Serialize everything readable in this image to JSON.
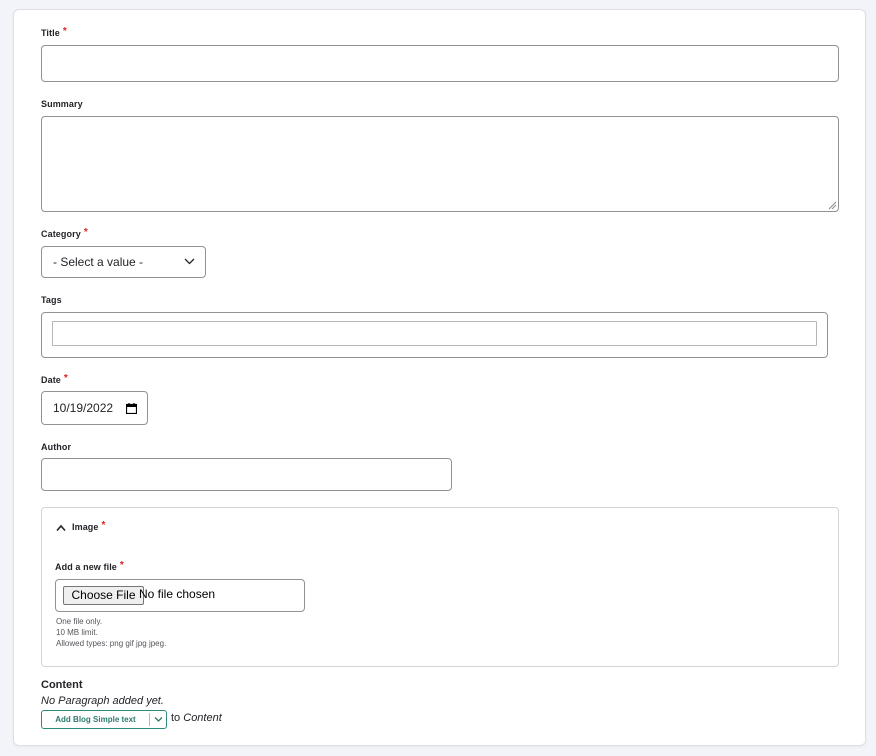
{
  "form": {
    "title": {
      "label": "Title",
      "required_mark": "*",
      "value": ""
    },
    "summary": {
      "label": "Summary",
      "value": ""
    },
    "category": {
      "label": "Category",
      "required_mark": "*",
      "selected": "- Select a value -"
    },
    "tags": {
      "label": "Tags",
      "value": ""
    },
    "date": {
      "label": "Date",
      "required_mark": "*",
      "value": "10/19/2022"
    },
    "author": {
      "label": "Author",
      "value": ""
    },
    "image": {
      "legend": "Image",
      "required_mark": "*",
      "add_file_label": "Add a new file",
      "add_file_required_mark": "*",
      "choose_button": "Choose File",
      "no_file_text": "No file chosen",
      "help": [
        "One file only.",
        "10 MB limit.",
        "Allowed types: png gif jpg jpeg."
      ]
    },
    "content": {
      "heading": "Content",
      "empty_text": "No Paragraph added yet.",
      "add_button": "Add Blog Simple text",
      "to_text": "to",
      "to_target": "Content"
    }
  },
  "colors": {
    "required": "#dc2323",
    "accent": "#2b8a7e",
    "border": "#919297"
  },
  "icons": [
    "chevron-down-icon",
    "calendar-icon",
    "chevron-up-icon",
    "resize-handle-icon"
  ]
}
